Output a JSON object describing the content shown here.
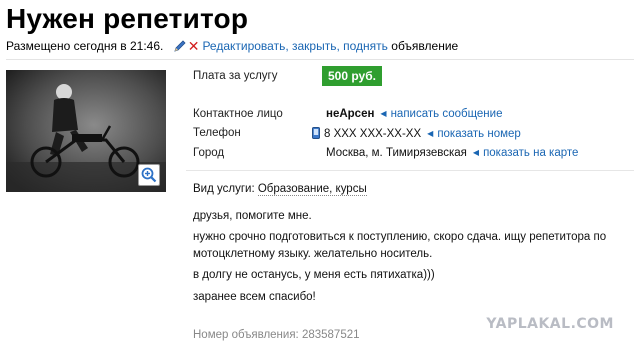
{
  "header": {
    "title": "Нужен репетитор",
    "posted": "Размещено сегодня в 21:46.",
    "edit_link": "Редактировать, закрыть, поднять",
    "edit_suffix": "объявление"
  },
  "listing": {
    "price_label": "Плата за услугу",
    "price_value": "500 руб.",
    "contact_label": "Контактное лицо",
    "contact_value": "неАрсен",
    "contact_link": "написать сообщение",
    "phone_label": "Телефон",
    "phone_value": "8 XXX XXX-XX-XX",
    "phone_link": "показать номер",
    "city_label": "Город",
    "city_value": "Москва, м. Тимирязевская",
    "city_link": "показать на карте",
    "service_label": "Вид услуги:",
    "service_value": "Образование, курсы"
  },
  "description": [
    "друзья, помогите мне.",
    "нужно срочно подготовиться к поступлению, скоро сдача. ищу репетитора по мотоцклетному языку. желательно носитель.",
    "в долгу не останусь, у меня есть пятихатка)))",
    "заранее всем спасибо!"
  ],
  "footer": {
    "ad_number": "Номер объявления: 283587521"
  },
  "watermark": "YAPLAKAL.COM",
  "colors": {
    "link": "#1a66b3",
    "price_badge": "#2f9e2f",
    "delete_cross": "#d21f1f"
  },
  "icons": {
    "edit": "pencil-icon",
    "delete": "close-icon",
    "zoom": "magnifier-plus-icon",
    "phone": "phone-icon",
    "link_marker": "triangle-left-icon"
  }
}
